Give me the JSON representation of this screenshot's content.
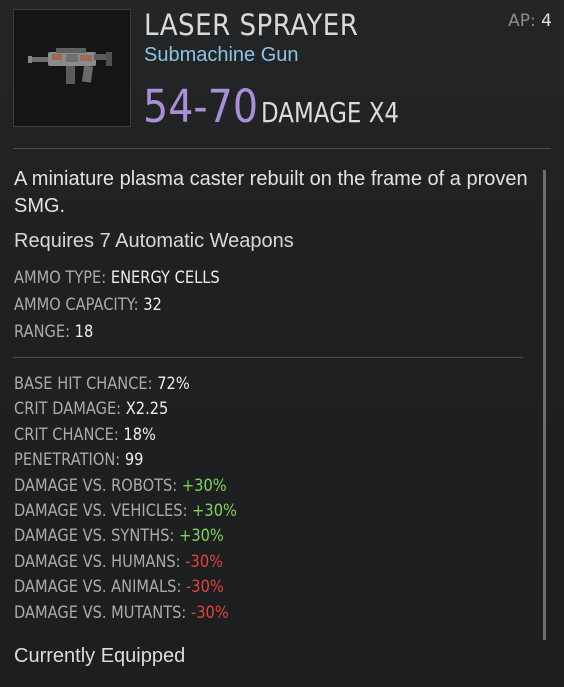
{
  "item": {
    "name": "LASER SPRAYER",
    "type": "Submachine Gun",
    "ap_label": "AP:",
    "ap_value": "4",
    "damage_range": "54-70",
    "damage_multiplier": "DAMAGE X4",
    "description": "A miniature plasma caster rebuilt on the frame of a proven SMG.",
    "requires": "Requires 7 Automatic Weapons",
    "equipped_text": "Currently Equipped"
  },
  "basic_stats": [
    {
      "label": "AMMO TYPE:",
      "value": "ENERGY CELLS",
      "tone": "neutral"
    },
    {
      "label": "AMMO CAPACITY:",
      "value": "32",
      "tone": "neutral"
    },
    {
      "label": "RANGE:",
      "value": "18",
      "tone": "neutral"
    }
  ],
  "combat_stats": [
    {
      "label": "BASE HIT CHANCE:",
      "value": "72%",
      "tone": "neutral"
    },
    {
      "label": "CRIT DAMAGE:",
      "value": "X2.25",
      "tone": "neutral"
    },
    {
      "label": "CRIT CHANCE:",
      "value": "18%",
      "tone": "neutral"
    },
    {
      "label": "PENETRATION:",
      "value": "99",
      "tone": "neutral"
    },
    {
      "label": "DAMAGE VS. ROBOTS:",
      "value": "+30%",
      "tone": "positive"
    },
    {
      "label": "DAMAGE VS. VEHICLES:",
      "value": "+30%",
      "tone": "positive"
    },
    {
      "label": "DAMAGE VS. SYNTHS:",
      "value": "+30%",
      "tone": "positive"
    },
    {
      "label": "DAMAGE VS. HUMANS:",
      "value": "-30%",
      "tone": "negative"
    },
    {
      "label": "DAMAGE VS. ANIMALS:",
      "value": "-30%",
      "tone": "negative"
    },
    {
      "label": "DAMAGE VS. MUTANTS:",
      "value": "-30%",
      "tone": "negative"
    }
  ],
  "colors": {
    "damage": "#a98fd6",
    "subtitle": "#8ec3e6",
    "positive": "#7fd45a",
    "negative": "#e0443a"
  },
  "icons": {
    "weapon": "smg-weapon-icon"
  }
}
